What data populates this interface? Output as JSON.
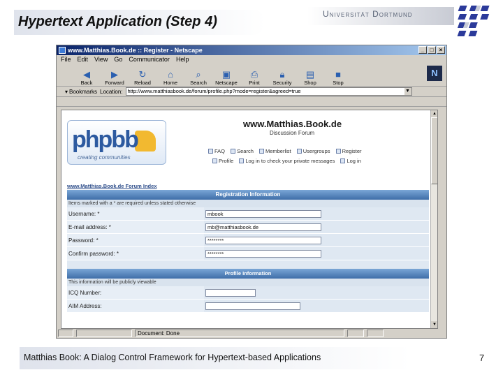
{
  "slide": {
    "title": "Hypertext Application (Step 4)",
    "university": "Universität Dortmund",
    "footer": "Matthias Book: A Dialog Control Framework for Hypertext-based Applications",
    "page_number": "7"
  },
  "browser": {
    "window_title": "www.Matthias.Book.de :: Register - Netscape",
    "menu": [
      "File",
      "Edit",
      "View",
      "Go",
      "Communicator",
      "Help"
    ],
    "toolbar": [
      "Back",
      "Forward",
      "Reload",
      "Home",
      "Search",
      "Netscape",
      "Print",
      "Security",
      "Shop",
      "Stop"
    ],
    "bookmarks_label": "Bookmarks",
    "location_label": "Location:",
    "location_url": "http://www.matthiasbook.de/forum/profile.php?mode=register&agreed=true",
    "status_text": "Document: Done"
  },
  "page": {
    "logo_text": "phpbb",
    "logo_tagline": "creating communities",
    "site_title": "www.Matthias.Book.de",
    "site_subtitle": "Discussion Forum",
    "nav_row1": [
      "FAQ",
      "Search",
      "Memberlist",
      "Usergroups",
      "Register"
    ],
    "nav_row2": [
      "Profile",
      "Log in to check your private messages",
      "Log in"
    ],
    "forum_index": "www.Matthias.Book.de Forum Index",
    "reg_header": "Registration Information",
    "reg_notice": "Items marked with a * are required unless stated otherwise",
    "fields": [
      {
        "label": "Username: *",
        "value": "mbook"
      },
      {
        "label": "E-mail address: *",
        "value": "mb@matthiasbook.de"
      },
      {
        "label": "Password: *",
        "value": "********"
      },
      {
        "label": "Confirm password: *",
        "value": "********"
      }
    ],
    "profile_header": "Profile Information",
    "profile_notice": "This information will be publicly viewable",
    "profile_fields": [
      {
        "label": "ICQ Number:",
        "value": ""
      },
      {
        "label": "AIM Address:",
        "value": ""
      }
    ]
  }
}
